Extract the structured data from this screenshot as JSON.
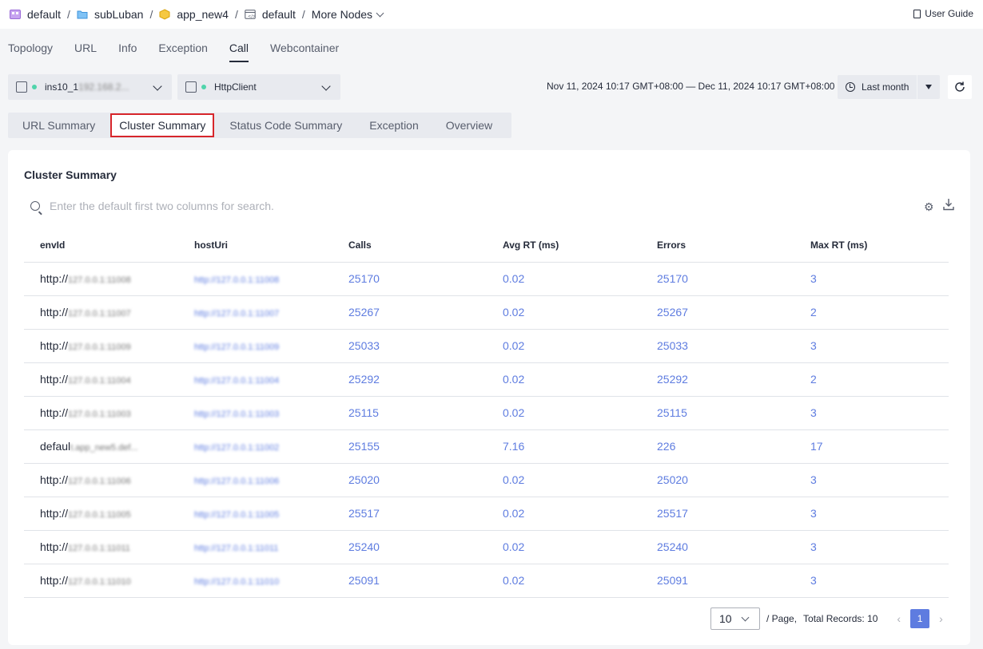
{
  "breadcrumb": [
    {
      "label": "default",
      "icon": "project-icon"
    },
    {
      "label": "subLuban",
      "icon": "folder-icon"
    },
    {
      "label": "app_new4",
      "icon": "app-icon"
    },
    {
      "label": "default",
      "icon": "environment-icon"
    }
  ],
  "breadcrumb_more": "More Nodes",
  "user_guide": "User Guide",
  "main_tabs": [
    "Topology",
    "URL",
    "Info",
    "Exception",
    "Call",
    "Webcontainer"
  ],
  "main_tab_active": "Call",
  "filters": {
    "instance": {
      "prefix": "ins10_1",
      "blurred": "192.168.2...",
      "status_color": "#50d4ab"
    },
    "call_type": {
      "label": "HttpClient",
      "status_color": "#50d4ab"
    }
  },
  "date_range": "Nov 11, 2024 10:17 GMT+08:00 — Dec 11, 2024 10:17 GMT+08:00",
  "period": "Last month",
  "sub_tabs": [
    "URL Summary",
    "Cluster Summary",
    "Status Code Summary",
    "Exception",
    "Overview"
  ],
  "sub_tab_active": "Cluster Summary",
  "card": {
    "title": "Cluster Summary",
    "search_placeholder": "Enter the default first two columns for search."
  },
  "table": {
    "headers": [
      "envId",
      "hostUri",
      "Calls",
      "Avg RT (ms)",
      "Errors",
      "Max RT (ms)"
    ],
    "rows": [
      {
        "env_prefix": "http://",
        "env_blur": "127.0.0.1:11008",
        "host_blur": "http://127.0.0.1:11008",
        "calls": "25170",
        "avg": "0.02",
        "errors": "25170",
        "max": "3"
      },
      {
        "env_prefix": "http://",
        "env_blur": "127.0.0.1:11007",
        "host_blur": "http://127.0.0.1:11007",
        "calls": "25267",
        "avg": "0.02",
        "errors": "25267",
        "max": "2"
      },
      {
        "env_prefix": "http://",
        "env_blur": "127.0.0.1:11009",
        "host_blur": "http://127.0.0.1:11009",
        "calls": "25033",
        "avg": "0.02",
        "errors": "25033",
        "max": "3"
      },
      {
        "env_prefix": "http://",
        "env_blur": "127.0.0.1:11004",
        "host_blur": "http://127.0.0.1:11004",
        "calls": "25292",
        "avg": "0.02",
        "errors": "25292",
        "max": "2"
      },
      {
        "env_prefix": "http://",
        "env_blur": "127.0.0.1:11003",
        "host_blur": "http://127.0.0.1:11003",
        "calls": "25115",
        "avg": "0.02",
        "errors": "25115",
        "max": "3"
      },
      {
        "env_prefix": "defaul",
        "env_blur": "t.app_new5.def...",
        "host_blur": "http://127.0.0.1:11002",
        "calls": "25155",
        "avg": "7.16",
        "errors": "226",
        "max": "17"
      },
      {
        "env_prefix": "http://",
        "env_blur": "127.0.0.1:11006",
        "host_blur": "http://127.0.0.1:11006",
        "calls": "25020",
        "avg": "0.02",
        "errors": "25020",
        "max": "3"
      },
      {
        "env_prefix": "http://",
        "env_blur": "127.0.0.1:11005",
        "host_blur": "http://127.0.0.1:11005",
        "calls": "25517",
        "avg": "0.02",
        "errors": "25517",
        "max": "3"
      },
      {
        "env_prefix": "http://",
        "env_blur": "127.0.0.1:11011",
        "host_blur": "http://127.0.0.1:11011",
        "calls": "25240",
        "avg": "0.02",
        "errors": "25240",
        "max": "3"
      },
      {
        "env_prefix": "http://",
        "env_blur": "127.0.0.1:11010",
        "host_blur": "http://127.0.0.1:11010",
        "calls": "25091",
        "avg": "0.02",
        "errors": "25091",
        "max": "3"
      }
    ]
  },
  "pagination": {
    "page_size": "10",
    "per_page_label": "/ Page,",
    "total_label": "Total Records: 10",
    "current_page": "1"
  },
  "colors": {
    "accent": "#5e7ce0",
    "highlight_border": "#d7262b"
  }
}
